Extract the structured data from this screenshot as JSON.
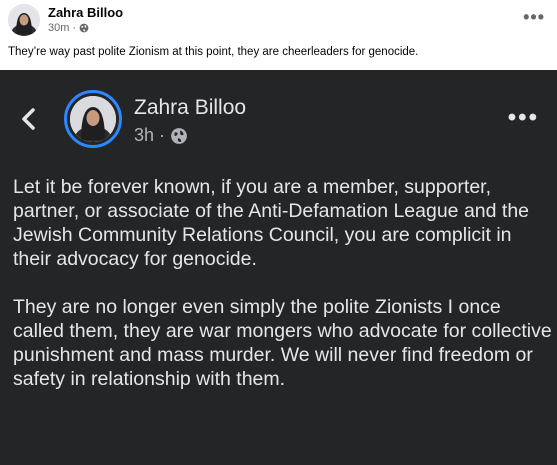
{
  "outer_post": {
    "author": "Zahra Billoo",
    "time": "30m",
    "separator": "·",
    "privacy_icon": "globe-icon",
    "more_icon": "more-options-icon",
    "more_label": "•••",
    "caption": "They’re way past polite Zionism at this point, they are cheerleaders for genocide."
  },
  "shared_screenshot": {
    "back_icon": "chevron-left-icon",
    "author": "Zahra Billoo",
    "time": "3h",
    "separator": "·",
    "privacy_icon": "globe-icon",
    "more_label": "•••",
    "paragraphs": [
      "Let it be forever known, if you are a member, supporter, partner, or associate of the Anti-Defamation League and the Jewish Community Relations Council, you are complicit in their advocacy for genocide.",
      "They are no longer even simply the polite Zionists I once called them, they are war mongers who advocate for collective punishment and mass murder. We will never find freedom or safety in relationship with them."
    ]
  },
  "colors": {
    "dark_background": "#242526",
    "dark_text": "#e4e6eb",
    "dark_muted": "#b0b3b8",
    "avatar_ring": "#2d88ff",
    "light_muted": "#65676b"
  }
}
